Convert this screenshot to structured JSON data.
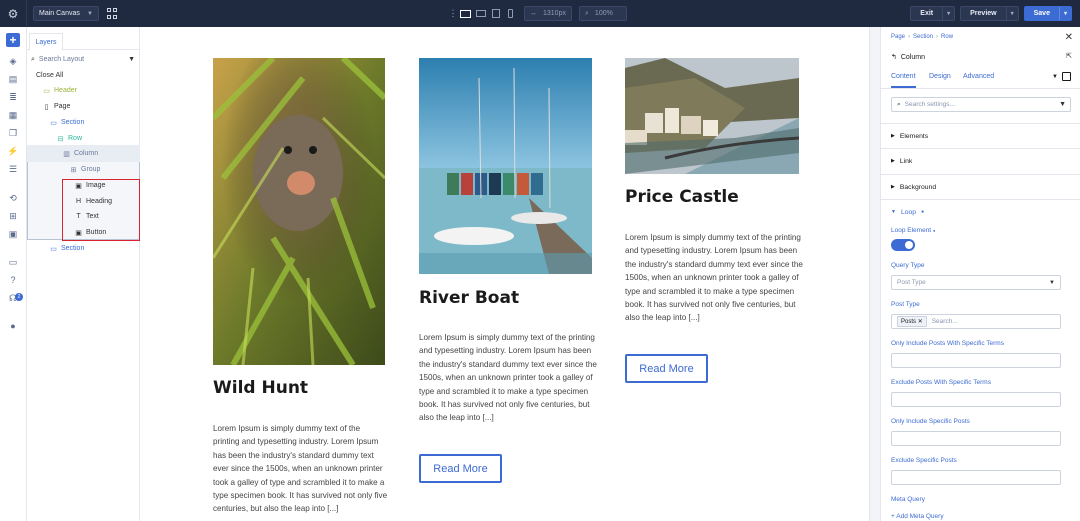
{
  "topbar": {
    "canvas_select": "Main Canvas",
    "width_value": "1310px",
    "zoom_value": "100%",
    "exit_label": "Exit",
    "preview_label": "Preview",
    "save_label": "Save"
  },
  "layers": {
    "tab_label": "Layers",
    "search_placeholder": "Search Layout",
    "items": [
      {
        "label": "Close All"
      },
      {
        "label": "Header"
      },
      {
        "label": "Page"
      },
      {
        "label": "Section"
      },
      {
        "label": "Row"
      },
      {
        "label": "Column"
      },
      {
        "label": "Group"
      },
      {
        "label": "Image"
      },
      {
        "label": "Heading"
      },
      {
        "label": "Text"
      },
      {
        "label": "Button"
      },
      {
        "label": "Section"
      }
    ]
  },
  "canvas": {
    "cards": [
      {
        "title": "Wild Hunt",
        "text": "Lorem Ipsum is simply dummy text of the printing and typesetting industry. Lorem Ipsum has been the industry's standard dummy text ever since the 1500s, when an unknown printer took a galley of type and scrambled it to make a type specimen book. It has survived not only five centuries, but also the leap into [...]",
        "button": "Read More"
      },
      {
        "title": "River Boat",
        "text": "Lorem Ipsum is simply dummy text of the printing and typesetting industry. Lorem Ipsum has been the industry's standard dummy text ever since the 1500s, when an unknown printer took a galley of type and scrambled it to make a type specimen book. It has survived not only five centuries, but also the leap into [...]",
        "button": "Read More"
      },
      {
        "title": "Price Castle",
        "text": "Lorem Ipsum is simply dummy text of the printing and typesetting industry. Lorem Ipsum has been the industry's standard dummy text ever since the 1500s, when an unknown printer took a galley of type and scrambled it to make a type specimen book. It has survived not only five centuries, but also the leap into [...]",
        "button": "Read More"
      }
    ]
  },
  "settings": {
    "breadcrumb": [
      "Page",
      "Section",
      "Row"
    ],
    "title": "Column",
    "tabs": [
      "Content",
      "Design",
      "Advanced"
    ],
    "search_placeholder": "Search settings...",
    "sections": [
      "Elements",
      "Link",
      "Background",
      "Loop"
    ],
    "loop_element_label": "Loop Element",
    "loop_element_on": true,
    "query_type_label": "Query Type",
    "query_type_placeholder": "Post Type",
    "post_type_label": "Post Type",
    "post_type_chip": "Posts",
    "post_type_search": "Search...",
    "only_terms_label": "Only Include Posts With Specific Terms",
    "exclude_terms_label": "Exclude Posts With Specific Terms",
    "only_posts_label": "Only Include Specific Posts",
    "exclude_posts_label": "Exclude Specific Posts",
    "meta_query_label": "Meta Query",
    "add_meta_query": "Add Meta Query"
  },
  "colors": {
    "accent": "#3c6bd3",
    "topbar": "#1f2940",
    "highlight": "#d9232f"
  }
}
